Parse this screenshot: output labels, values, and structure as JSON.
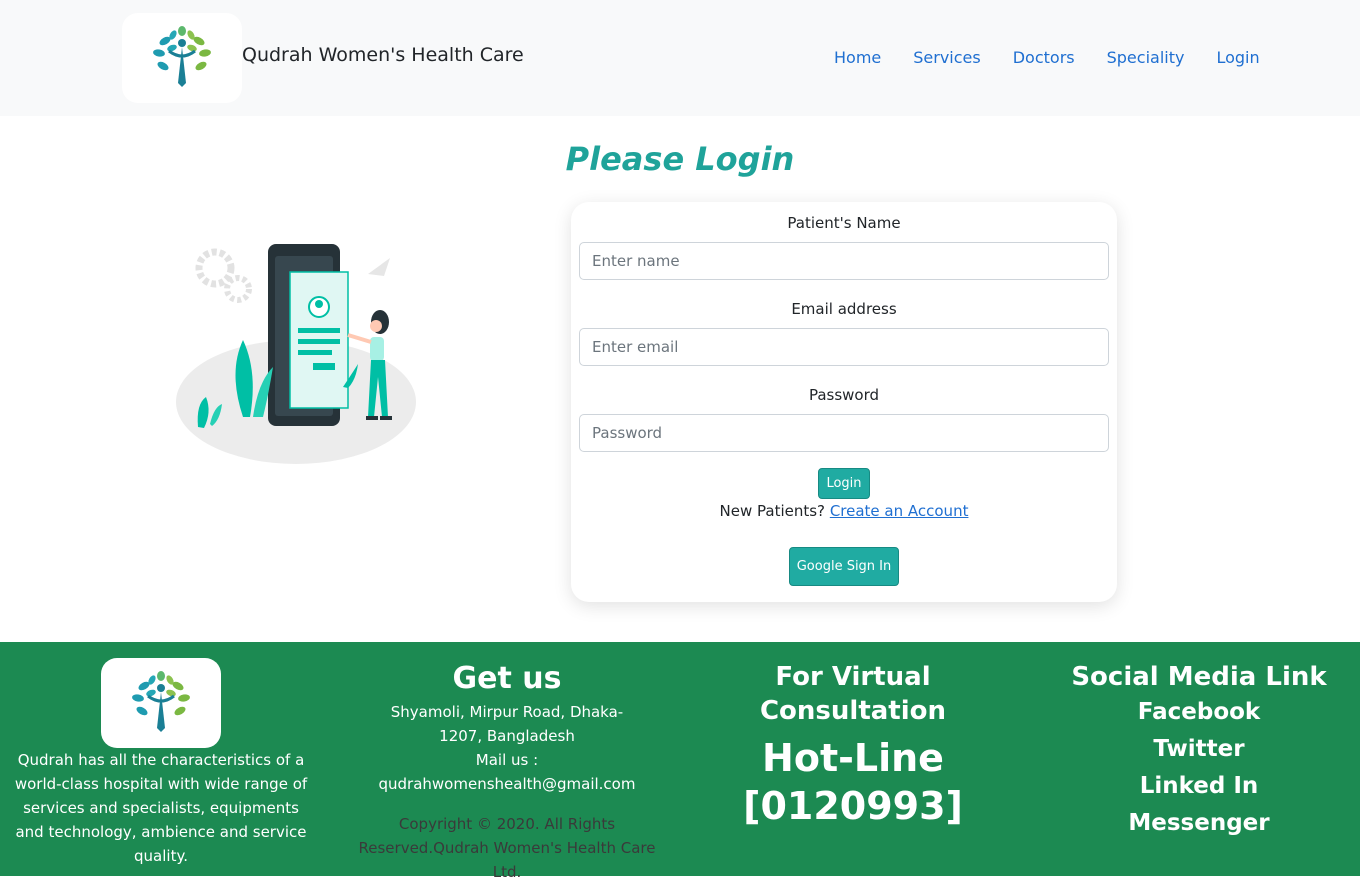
{
  "header": {
    "brand": "Qudrah Women's Health Care",
    "nav": [
      "Home",
      "Services",
      "Doctors",
      "Speciality",
      "Login"
    ]
  },
  "login": {
    "title": "Please Login",
    "name_label": "Patient's Name",
    "name_placeholder": "Enter name",
    "email_label": "Email address",
    "email_placeholder": "Enter email",
    "password_label": "Password",
    "password_placeholder": "Password",
    "login_button": "Login",
    "new_patients_text": "New Patients?",
    "create_account_link": "Create an Account",
    "google_button": "Google Sign In"
  },
  "footer": {
    "about": "Qudrah has all the characteristics of a world-class hospital with wide range of services and specialists, equipments and technology, ambience and service quality.",
    "get_us_title": "Get us",
    "address": "Shyamoli, Mirpur Road, Dhaka-1207, Bangladesh",
    "mail": "Mail us : qudrahwomenshealth@gmail.com",
    "copyright": "Copyright © 2020. All Rights Reserved.Qudrah Women's Health Care Ltd.",
    "virtual_title": "For Virtual Consultation",
    "hotline_label": "Hot-Line",
    "hotline_number": "[0120993]",
    "social_title": "Social Media Link",
    "social_links": [
      "Facebook",
      "Twitter",
      "Linked In",
      "Messenger"
    ]
  },
  "colors": {
    "accent": "#20aba2",
    "footer": "#1c8a52",
    "link": "#1f6fd1"
  },
  "icons": {
    "logo": "tree-of-life-logo-icon",
    "illustration": "phone-login-illustration"
  }
}
